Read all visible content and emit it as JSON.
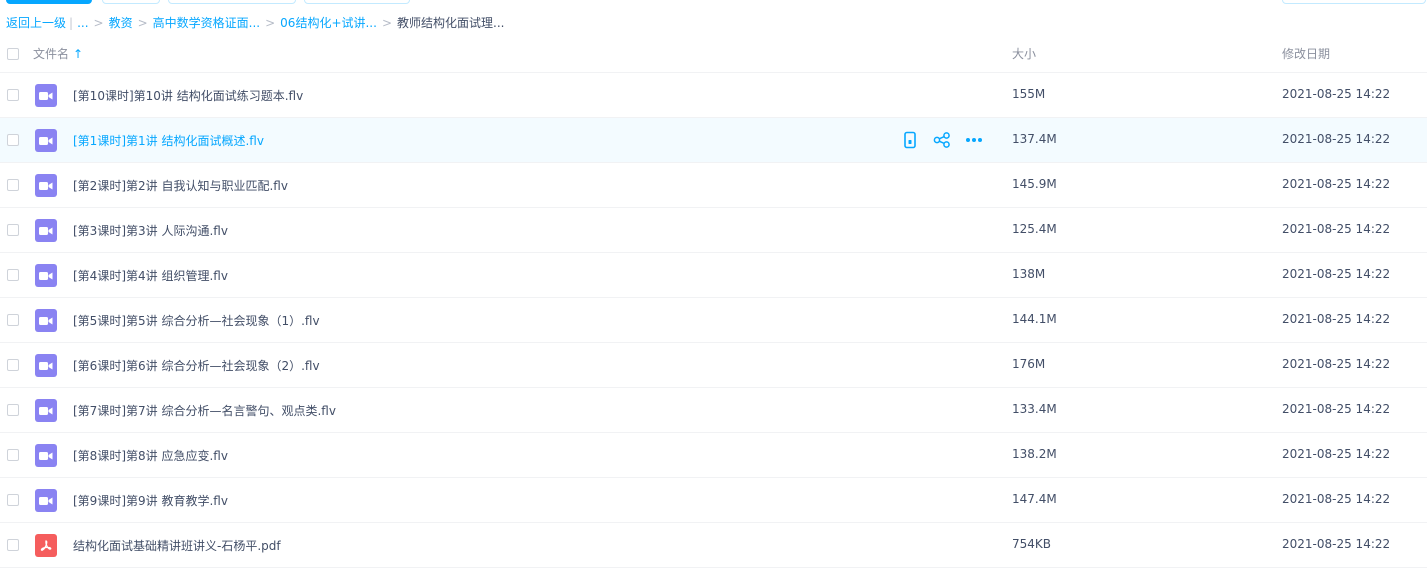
{
  "breadcrumb": {
    "back": "返回上一级",
    "ellipsis": "...",
    "items": [
      "教资",
      "高中数学资格证面...",
      "06结构化+试讲...",
      "教师结构化面试理..."
    ],
    "separator": ">"
  },
  "header": {
    "name_label": "文件名",
    "sort_icon": "↑",
    "size_label": "大小",
    "date_label": "修改日期"
  },
  "files": [
    {
      "name": "[第10课时]第10讲 结构化面试练习题本.flv",
      "size": "155M",
      "date": "2021-08-25 14:22",
      "type": "video"
    },
    {
      "name": "[第1课时]第1讲 结构化面试概述.flv",
      "size": "137.4M",
      "date": "2021-08-25 14:22",
      "type": "video"
    },
    {
      "name": "[第2课时]第2讲 自我认知与职业匹配.flv",
      "size": "145.9M",
      "date": "2021-08-25 14:22",
      "type": "video"
    },
    {
      "name": "[第3课时]第3讲 人际沟通.flv",
      "size": "125.4M",
      "date": "2021-08-25 14:22",
      "type": "video"
    },
    {
      "name": "[第4课时]第4讲 组织管理.flv",
      "size": "138M",
      "date": "2021-08-25 14:22",
      "type": "video"
    },
    {
      "name": "[第5课时]第5讲 综合分析—社会现象（1）.flv",
      "size": "144.1M",
      "date": "2021-08-25 14:22",
      "type": "video"
    },
    {
      "name": "[第6课时]第6讲 综合分析—社会现象（2）.flv",
      "size": "176M",
      "date": "2021-08-25 14:22",
      "type": "video"
    },
    {
      "name": "[第7课时]第7讲 综合分析—名言警句、观点类.flv",
      "size": "133.4M",
      "date": "2021-08-25 14:22",
      "type": "video"
    },
    {
      "name": "[第8课时]第8讲 应急应变.flv",
      "size": "138.2M",
      "date": "2021-08-25 14:22",
      "type": "video"
    },
    {
      "name": "[第9课时]第9讲 教育教学.flv",
      "size": "147.4M",
      "date": "2021-08-25 14:22",
      "type": "video"
    },
    {
      "name": "结构化面试基础精讲班讲义-石杨平.pdf",
      "size": "754KB",
      "date": "2021-08-25 14:22",
      "type": "pdf"
    }
  ],
  "icons": {
    "video": "video-file-icon",
    "pdf": "pdf-file-icon",
    "actions": [
      "phone-icon",
      "share-icon",
      "more-icon"
    ]
  },
  "colors": {
    "accent": "#06a7ff",
    "video_icon": "#8a83f2",
    "pdf_icon": "#f55d5d",
    "hover_row": "#f3fbff"
  }
}
